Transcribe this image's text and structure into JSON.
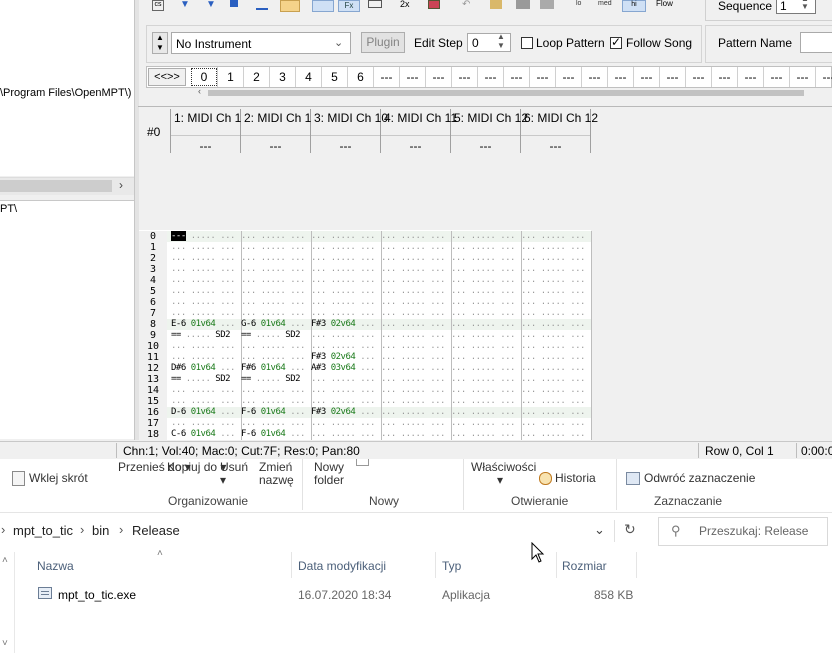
{
  "explorer": {
    "ribbon": {
      "items": {
        "paste_shortcut": "Wklej skrót",
        "move_to": "Przenieś do",
        "copy_to": "Kopiuj do",
        "delete": "Usuń",
        "rename": "Zmień nazwę",
        "new_folder": "Nowy folder",
        "properties": "Właściwości",
        "history": "Historia",
        "invert_selection": "Odwróć zaznaczenie"
      },
      "groups": {
        "organize": "Organizowanie",
        "new": "Nowy",
        "open": "Otwieranie",
        "select": "Zaznaczanie"
      }
    },
    "address": {
      "crumbs": [
        "mpt_to_tic",
        "bin",
        "Release"
      ]
    },
    "search": {
      "placeholder": "Przeszukaj: Release"
    },
    "columns": {
      "name": "Nazwa",
      "modified": "Data modyfikacji",
      "type": "Typ",
      "size": "Rozmiar"
    },
    "files": [
      {
        "name": "mpt_to_tic.exe",
        "modified": "16.07.2020 18:34",
        "type": "Aplikacja",
        "size": "858 KB"
      }
    ]
  },
  "mpt": {
    "left": {
      "path1": "\\Program Files\\OpenMPT\\)",
      "path2": "PT\\"
    },
    "toolbar": {
      "flow_label": "Flow",
      "sequence_label": "Sequence",
      "sequence_value": "1"
    },
    "instrument": {
      "selected": "No Instrument",
      "plugin_button": "Plugin",
      "edit_step_label": "Edit Step",
      "edit_step_value": "0",
      "loop_pattern_label": "Loop Pattern",
      "loop_pattern_checked": false,
      "follow_song_label": "Follow Song",
      "follow_song_checked": true,
      "pattern_name_label": "Pattern Name"
    },
    "sequence": {
      "nav_label": "<<>>",
      "items": [
        "0",
        "1",
        "2",
        "3",
        "4",
        "5",
        "6",
        "---",
        "---",
        "---",
        "---",
        "---",
        "---",
        "---",
        "---",
        "---",
        "---",
        "---",
        "---",
        "---",
        "---",
        "---",
        "---",
        "---",
        "---"
      ]
    },
    "pattern": {
      "pattern_number": "#0",
      "channels": [
        {
          "name": "1: MIDI Ch 1",
          "plugin": "---"
        },
        {
          "name": "2: MIDI Ch 1",
          "plugin": "---"
        },
        {
          "name": "3: MIDI Ch 10",
          "plugin": "---"
        },
        {
          "name": "4: MIDI Ch 11",
          "plugin": "---"
        },
        {
          "name": "5: MIDI Ch 12",
          "plugin": "---"
        },
        {
          "name": "6: MIDI Ch 12",
          "plugin": "---"
        }
      ],
      "rows": [
        {
          "n": "0",
          "cells": [
            [
              "---",
              "..",
              "...",
              "..."
            ],
            [
              "...",
              "..",
              "...",
              "..."
            ],
            [
              "...",
              "..",
              "...",
              "..."
            ],
            [
              "...",
              "..",
              "...",
              "..."
            ],
            [
              "...",
              "..",
              "...",
              "..."
            ],
            [
              "...",
              "..",
              "...",
              "..."
            ]
          ]
        },
        {
          "n": "1",
          "cells": []
        },
        {
          "n": "2",
          "cells": []
        },
        {
          "n": "3",
          "cells": []
        },
        {
          "n": "4",
          "cells": []
        },
        {
          "n": "5",
          "cells": []
        },
        {
          "n": "6",
          "cells": []
        },
        {
          "n": "7",
          "cells": []
        },
        {
          "n": "8",
          "cells": [
            [
              "E-6",
              "01",
              "v64",
              "..."
            ],
            [
              "G-6",
              "01",
              "v64",
              "..."
            ],
            [
              "F#3",
              "02",
              "v64",
              "..."
            ]
          ]
        },
        {
          "n": "9",
          "cells": [
            [
              "==",
              "..",
              "...",
              "SD2"
            ],
            [
              "==",
              "..",
              "...",
              "SD2"
            ]
          ]
        },
        {
          "n": "10",
          "cells": []
        },
        {
          "n": "11",
          "cells": [
            [],
            [],
            [
              "F#3",
              "02",
              "v64",
              "..."
            ]
          ]
        },
        {
          "n": "12",
          "cells": [
            [
              "D#6",
              "01",
              "v64",
              "..."
            ],
            [
              "F#6",
              "01",
              "v64",
              "..."
            ],
            [
              "A#3",
              "03",
              "v64",
              "..."
            ]
          ]
        },
        {
          "n": "13",
          "cells": [
            [
              "==",
              "..",
              "...",
              "SD2"
            ],
            [
              "==",
              "..",
              "...",
              "SD2"
            ]
          ]
        },
        {
          "n": "14",
          "cells": []
        },
        {
          "n": "15",
          "cells": []
        },
        {
          "n": "16",
          "cells": [
            [
              "D-6",
              "01",
              "v64",
              "..."
            ],
            [
              "F-6",
              "01",
              "v64",
              "..."
            ],
            [
              "F#3",
              "02",
              "v64",
              "..."
            ]
          ]
        },
        {
          "n": "17",
          "cells": []
        },
        {
          "n": "18",
          "cells": [
            [
              "C-6",
              "01",
              "v64",
              "..."
            ],
            [
              "F-6",
              "01",
              "v64",
              "..."
            ]
          ]
        }
      ]
    },
    "status": {
      "info": "Chn:1; Vol:40; Mac:0; Cut:7F; Res:0; Pan:80",
      "position": "Row 0, Col 1",
      "time": "0:00:0"
    }
  }
}
